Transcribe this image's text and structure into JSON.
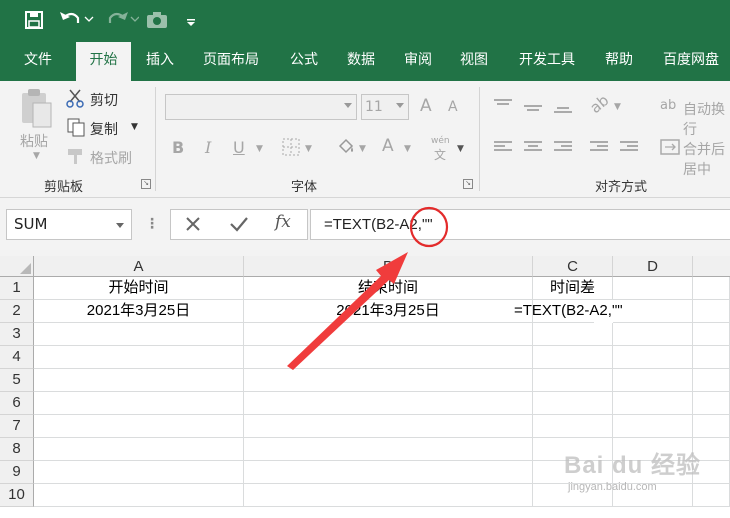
{
  "quick_access": {
    "save_icon": "save-icon",
    "undo_icon": "undo-icon",
    "redo_icon": "redo-icon",
    "camera_icon": "camera-icon",
    "customize_icon": "customize-qat-icon"
  },
  "tabs": [
    "文件",
    "开始",
    "插入",
    "页面布局",
    "公式",
    "数据",
    "审阅",
    "视图",
    "开发工具",
    "帮助",
    "百度网盘"
  ],
  "active_tab": "开始",
  "ribbon": {
    "clipboard": {
      "paste_label": "粘贴",
      "cut_label": "剪切",
      "copy_label": "复制",
      "format_painter_label": "格式刷",
      "group_label": "剪贴板"
    },
    "font": {
      "font_name": "",
      "font_size": "11",
      "grow_label": "A",
      "shrink_label": "A",
      "bold_label": "B",
      "italic_label": "I",
      "underline_label": "U",
      "font_color_label": "A",
      "phonetic_label": "wén",
      "group_label": "字体"
    },
    "alignment": {
      "wrap_text_label": "自动换行",
      "merge_label": "合并后居中",
      "group_label": "对齐方式"
    }
  },
  "formula_bar": {
    "name_box": "SUM",
    "cancel_icon": "cancel-icon",
    "enter_icon": "check-icon",
    "fx_label": "fx",
    "formula": "=TEXT(B2-A2,\"\""
  },
  "sheet": {
    "columns": [
      "A",
      "B",
      "C",
      "D"
    ],
    "rows": [
      "1",
      "2",
      "3",
      "4",
      "5",
      "6",
      "7",
      "8",
      "9",
      "10"
    ],
    "cells": {
      "A1": "开始时间",
      "B1": "结束时间",
      "C1": "时间差",
      "A2": "2021年3月25日",
      "B2": "2021年3月25日",
      "C2": "=TEXT(B2-A2,\"\""
    }
  },
  "annotation": {
    "arrow_color": "#f03c3c",
    "circle_color": "#e32b2b"
  },
  "watermark": {
    "text": "Bai du 经验",
    "url": "jingyan.baidu.com"
  },
  "colors": {
    "accent": "#217346"
  }
}
